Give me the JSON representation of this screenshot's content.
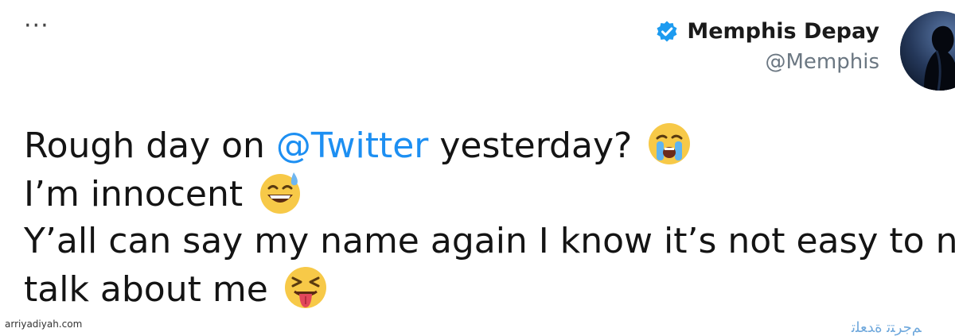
{
  "header": {
    "more_label": "···"
  },
  "author": {
    "display_name": "Memphis Depay",
    "handle": "@Memphis",
    "verified": true,
    "verified_color": "#1d9bf0"
  },
  "tweet": {
    "line1_before": "Rough day on ",
    "line1_mention": "@Twitter",
    "line1_after": " yesterday?",
    "line1_emoji": "loudly-crying-face",
    "line2_text": "I’m innocent",
    "line2_emoji": "grinning-face-with-sweat",
    "line3_text": "Y’all can say my name again I know it’s not easy to no",
    "line4_text": "talk about me",
    "line4_emoji": "squinting-face-with-tongue",
    "mention_color": "#1d8ff2"
  },
  "footer": {
    "watermark": "arriyadiyah.com",
    "translate_stub": "ﻢﺟﺮﺘﺗ ﺓﺪﻌﻠﺗ"
  }
}
